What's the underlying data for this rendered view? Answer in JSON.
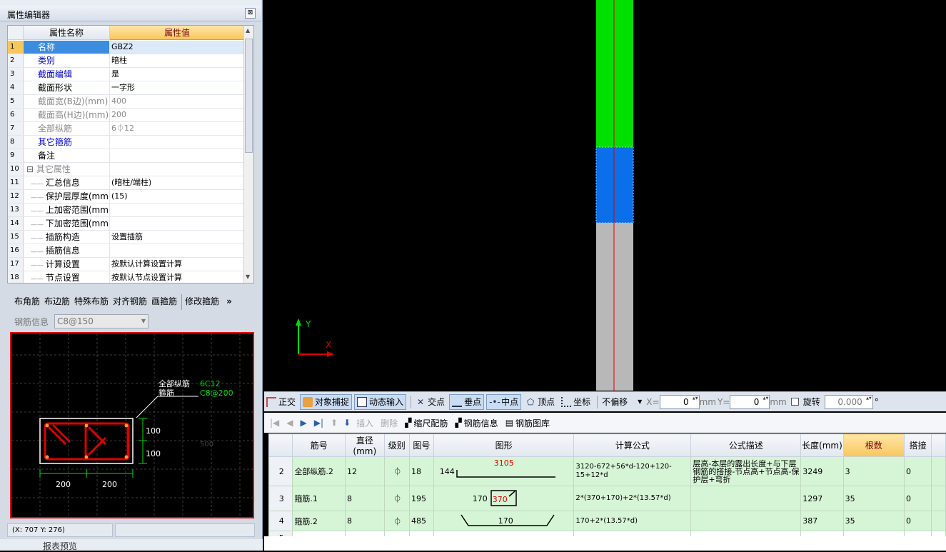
{
  "prop_editor": {
    "title": "属性编辑器",
    "close": "⊠",
    "col_name": "属性名称",
    "col_value": "属性值",
    "rows": [
      {
        "n": "1",
        "k": "名称",
        "v": "GBZ2",
        "style": "sel"
      },
      {
        "n": "2",
        "k": "类别",
        "v": "暗柱",
        "style": "blue"
      },
      {
        "n": "3",
        "k": "截面编辑",
        "v": "是",
        "style": "blue"
      },
      {
        "n": "4",
        "k": "截面形状",
        "v": "一字形",
        "style": ""
      },
      {
        "n": "5",
        "k": "截面宽(B边)(mm)",
        "v": "400",
        "style": "gray"
      },
      {
        "n": "6",
        "k": "截面高(H边)(mm)",
        "v": "200",
        "style": "gray"
      },
      {
        "n": "7",
        "k": "全部纵筋",
        "v": "6⏀12",
        "style": "gray"
      },
      {
        "n": "8",
        "k": "其它箍筋",
        "v": "",
        "style": "blue"
      },
      {
        "n": "9",
        "k": "备注",
        "v": "",
        "style": ""
      },
      {
        "n": "10",
        "k": "其它属性",
        "v": "",
        "style": "gray-group"
      },
      {
        "n": "11",
        "k": "汇总信息",
        "v": "(暗柱/端柱)",
        "style": "child"
      },
      {
        "n": "12",
        "k": "保护层厚度(mm)",
        "v": "(15)",
        "style": "child"
      },
      {
        "n": "13",
        "k": "上加密范围(mm)",
        "v": "",
        "style": "child"
      },
      {
        "n": "14",
        "k": "下加密范围(mm)",
        "v": "",
        "style": "child"
      },
      {
        "n": "15",
        "k": "插筋构造",
        "v": "设置插筋",
        "style": "child"
      },
      {
        "n": "16",
        "k": "插筋信息",
        "v": "",
        "style": "child"
      },
      {
        "n": "17",
        "k": "计算设置",
        "v": "按默认计算设置计算",
        "style": "child"
      },
      {
        "n": "18",
        "k": "节点设置",
        "v": "按默认节点设置计算",
        "style": "child"
      }
    ]
  },
  "rebar_toolbar": {
    "items": [
      "布角筋",
      "布边筋",
      "特殊布筋",
      "对齐钢筋",
      "画箍筋",
      "修改箍筋"
    ],
    "more": "»"
  },
  "rebar_info": {
    "label": "钢筋信息",
    "value": "C8@150"
  },
  "section": {
    "label_all": "全部纵筋",
    "label_stirrup": "箍筋",
    "val_all": "6C12",
    "val_stirrup": "C8@200",
    "dim_w1": "200",
    "dim_w2": "200",
    "dim_h1": "100",
    "dim_h2": "100",
    "faint": "500"
  },
  "status": {
    "coords": "(X: 707 Y: 276)"
  },
  "bottom_left_text": "报表预览",
  "axis": {
    "x": "X",
    "y": "Y"
  },
  "colors": {
    "green": "#00e000",
    "blue": "#0a6fe8",
    "gray": "#b8b8b8",
    "red": "#e00000"
  },
  "snap_bar": {
    "ortho": "正交",
    "snap": "对象捕捉",
    "dyn": "动态输入",
    "cross": "交点",
    "perp": "垂点",
    "mid": "中点",
    "vertex": "顶点",
    "coord": "坐标",
    "offset": "不偏移",
    "x_label": "X=",
    "x_val": "0",
    "mm1": "mm",
    "y_label": "Y=",
    "y_val": "0",
    "mm2": "mm",
    "rotate": "旋转",
    "rot_val": "0.000",
    "deg": "°"
  },
  "rebar_bar": {
    "insert": "插入",
    "delete": "删除",
    "scale": "缩尺配筋",
    "info": "钢筋信息",
    "lib": "钢筋图库"
  },
  "table": {
    "headers": [
      "筋号",
      "直径(mm)",
      "级别",
      "图号",
      "图形",
      "计算公式",
      "公式描述",
      "长度(mm)",
      "根数",
      "搭接"
    ],
    "rows": [
      {
        "n": "2",
        "name": "全部纵筋.2",
        "d": "12",
        "grade": "⏀",
        "fig": "18",
        "shape_a": "144",
        "shape_b": "3105",
        "formula": "3120-672+56*d-120+120-15+12*d",
        "desc": "层高-本层的露出长度+与下层钢筋的搭接-节点高+节点高-保护层+弯折",
        "len": "3249",
        "cnt": "3",
        "lap": "0"
      },
      {
        "n": "3",
        "name": "箍筋.1",
        "d": "8",
        "grade": "⏀",
        "fig": "195",
        "shape_a": "170",
        "shape_b": "370",
        "formula": "2*(370+170)+2*(13.57*d)",
        "desc": "",
        "len": "1297",
        "cnt": "35",
        "lap": "0"
      },
      {
        "n": "4",
        "name": "箍筋.2",
        "d": "8",
        "grade": "⏀",
        "fig": "485",
        "shape_a": "170",
        "shape_b": "",
        "formula": "170+2*(13.57*d)",
        "desc": "",
        "len": "387",
        "cnt": "35",
        "lap": "0"
      },
      {
        "n": "5",
        "name": "",
        "d": "",
        "grade": "",
        "fig": "",
        "shape_a": "",
        "shape_b": "",
        "formula": "",
        "desc": "",
        "len": "",
        "cnt": "",
        "lap": ""
      }
    ]
  }
}
